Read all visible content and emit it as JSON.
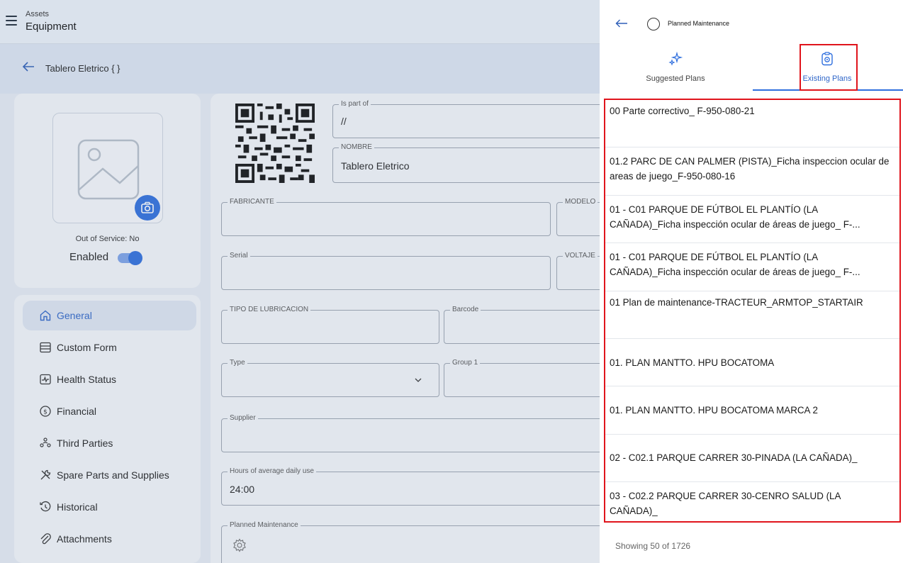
{
  "app": {
    "breadcrumb_section": "Assets",
    "breadcrumb_page": "Equipment",
    "asset_title": "Tablero Eletrico { }",
    "out_of_service": "Out of Service: No",
    "enabled_label": "Enabled",
    "enabled": true
  },
  "form": {
    "is_part_of": {
      "label": "Is part of",
      "value": "//"
    },
    "nombre": {
      "label": "NOMBRE",
      "value": "Tablero Eletrico"
    },
    "fabricante": {
      "label": "FABRICANTE",
      "value": ""
    },
    "modelo": {
      "label": "MODELO",
      "value": ""
    },
    "serial": {
      "label": "Serial",
      "value": ""
    },
    "voltaje": {
      "label": "VOLTAJE",
      "value": ""
    },
    "tipo_lubricacion": {
      "label": "TIPO DE LUBRICACION",
      "value": ""
    },
    "barcode": {
      "label": "Barcode",
      "value": ""
    },
    "type": {
      "label": "Type",
      "value": ""
    },
    "group1": {
      "label": "Group 1",
      "value": ""
    },
    "supplier": {
      "label": "Supplier",
      "value": ""
    },
    "hours": {
      "label": "Hours of average daily use",
      "value": "24:00"
    },
    "planned": {
      "label": "Planned Maintenance"
    }
  },
  "nav": [
    {
      "label": "General",
      "icon": "home-icon",
      "active": true
    },
    {
      "label": "Custom Form",
      "icon": "form-icon",
      "active": false
    },
    {
      "label": "Health Status",
      "icon": "health-icon",
      "active": false
    },
    {
      "label": "Financial",
      "icon": "dollar-icon",
      "active": false
    },
    {
      "label": "Third Parties",
      "icon": "people-icon",
      "active": false
    },
    {
      "label": "Spare Parts and Supplies",
      "icon": "tools-icon",
      "active": false
    },
    {
      "label": "Historical",
      "icon": "history-icon",
      "active": false
    },
    {
      "label": "Attachments",
      "icon": "paperclip-icon",
      "active": false
    }
  ],
  "panel": {
    "title": "Planned Maintenance",
    "tabs": [
      {
        "label": "Suggested Plans",
        "icon": "sparkle-icon",
        "selected": false
      },
      {
        "label": "Existing Plans",
        "icon": "clipboard-icon",
        "selected": true
      }
    ],
    "plans": [
      "00 Parte correctivo_ F-950-080-21",
      "01.2 PARC DE CAN PALMER (PISTA)_Ficha inspeccion ocular de areas de juego_F-950-080-16",
      "01 - C01 PARQUE DE FÚTBOL EL PLANTÍO (LA CAÑADA)_Ficha inspección ocular de áreas de juego_ F-...",
      "01 - C01 PARQUE DE FÚTBOL EL PLANTÍO (LA CAÑADA)_Ficha inspección ocular de áreas de juego_ F-...",
      "01 Plan de maintenance-TRACTEUR_ARMTOP_STARTAIR",
      "01. PLAN MANTTO. HPU BOCATOMA",
      "01. PLAN MANTTO. HPU BOCATOMA MARCA 2",
      "02 - C02.1 PARQUE CARRER 30-PINADA (LA CAÑADA)_",
      "03 - C02.2 PARQUE CARRER 30-CENRO SALUD (LA CAÑADA)_"
    ],
    "footer": "Showing 50 of 1726"
  },
  "colors": {
    "accent": "#2f6fde",
    "highlight": "#e0141c"
  }
}
